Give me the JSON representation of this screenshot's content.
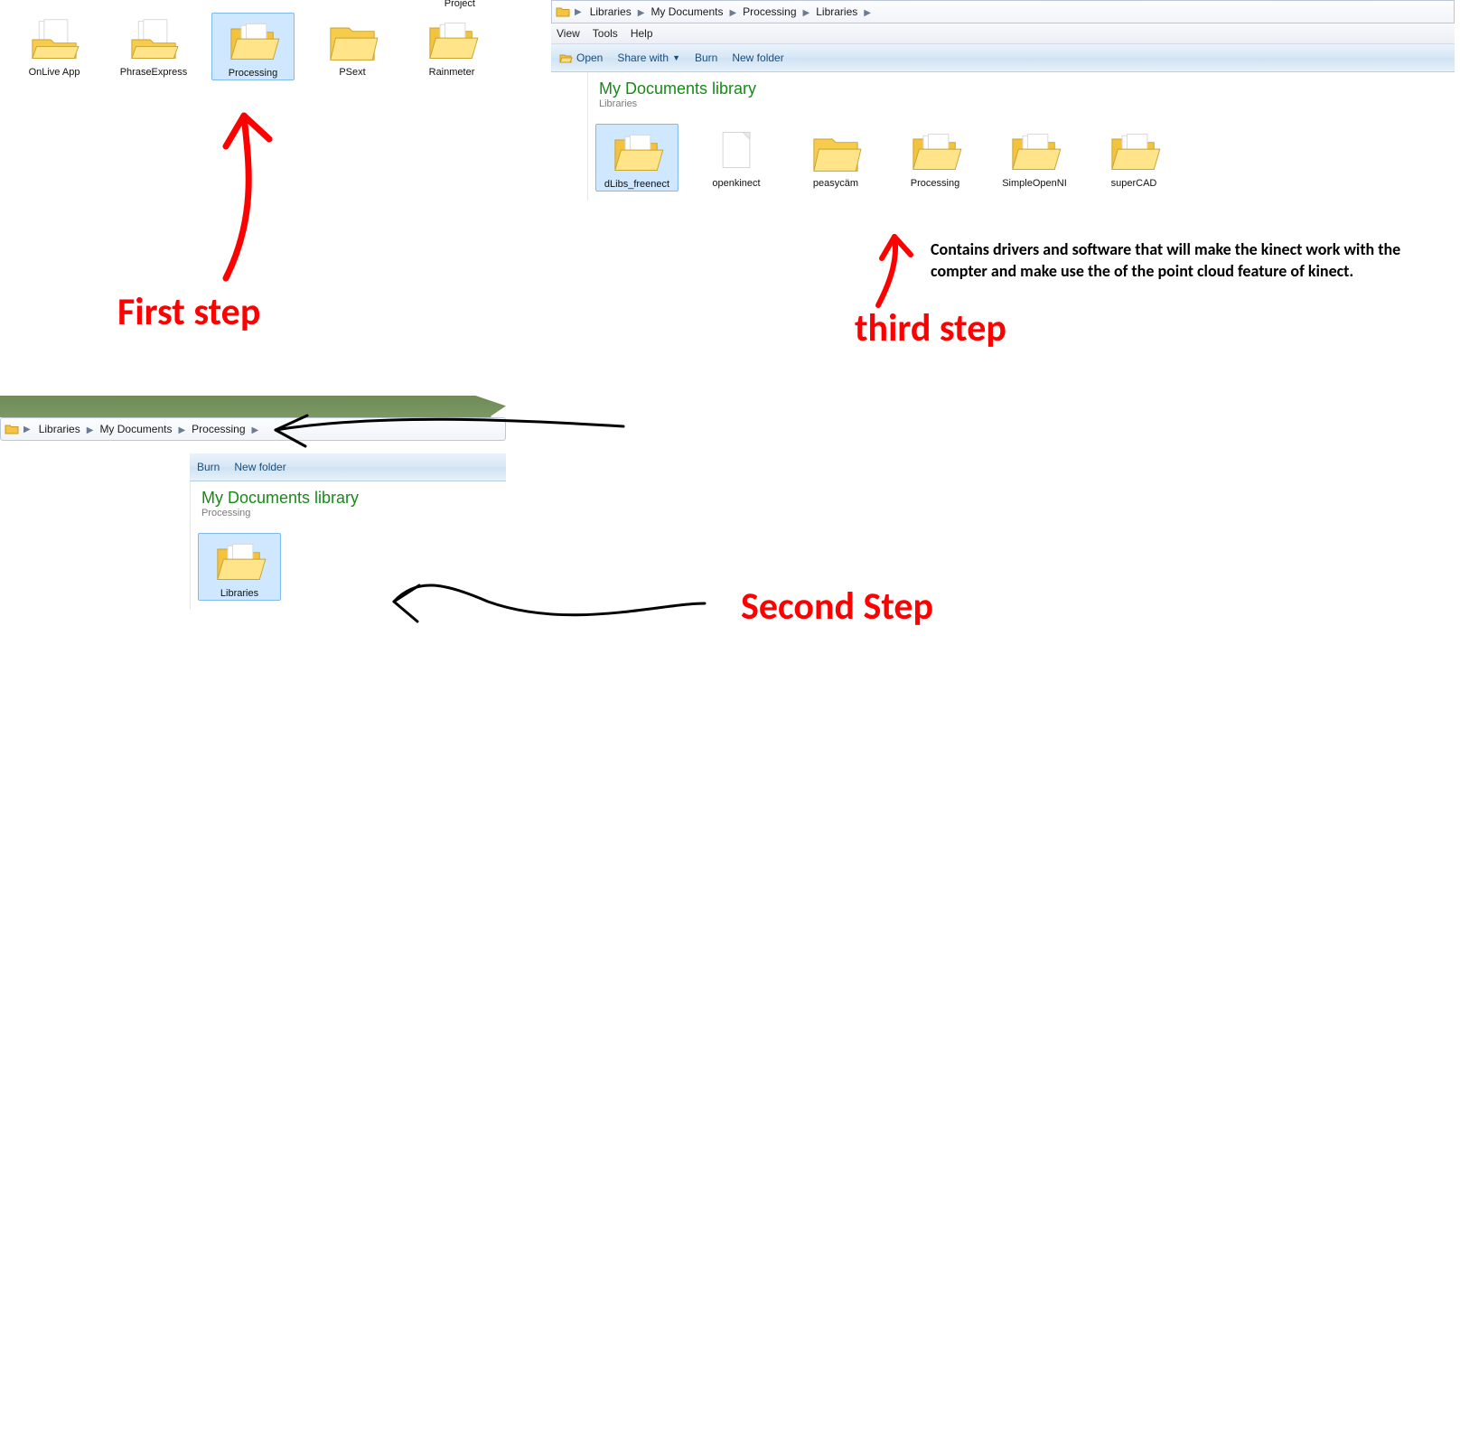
{
  "step1": {
    "label": "First step",
    "partial_label": "Project",
    "folders": [
      {
        "name": "OnLive App",
        "kind": "folder-paper"
      },
      {
        "name": "PhraseExpress",
        "kind": "folder-paper"
      },
      {
        "name": "Processing",
        "kind": "folder-open",
        "selected": true
      },
      {
        "name": "PSext",
        "kind": "folder"
      },
      {
        "name": "Rainmeter",
        "kind": "folder-open"
      }
    ]
  },
  "step2": {
    "label": "Second Step",
    "breadcrumb": [
      "Libraries",
      "My Documents",
      "Processing"
    ],
    "toolbar": {
      "burn": "Burn",
      "new_folder": "New folder"
    },
    "lib_title": "My Documents library",
    "lib_sub": "Processing",
    "folders": [
      {
        "name": "Libraries",
        "kind": "folder-open",
        "selected": true
      }
    ]
  },
  "step3": {
    "label": "third step",
    "breadcrumb": [
      "Libraries",
      "My Documents",
      "Processing",
      "Libraries"
    ],
    "menu": {
      "view": "View",
      "tools": "Tools",
      "help": "Help"
    },
    "toolbar": {
      "open": "Open",
      "share": "Share with",
      "burn": "Burn",
      "new_folder": "New folder"
    },
    "lib_title": "My Documents library",
    "lib_sub": "Libraries",
    "folders": [
      {
        "name": "dLibs_freenect",
        "kind": "folder-open",
        "selected": true
      },
      {
        "name": "openkinect",
        "kind": "paper"
      },
      {
        "name": "peasycäm",
        "kind": "folder"
      },
      {
        "name": "Processing",
        "kind": "folder-open"
      },
      {
        "name": "SimpleOpenNI",
        "kind": "folder-open"
      },
      {
        "name": "superCAD",
        "kind": "folder-open"
      }
    ],
    "description": "Contains drivers and software that will make the kinect work with the compter and make use the of the point cloud feature of kinect."
  }
}
